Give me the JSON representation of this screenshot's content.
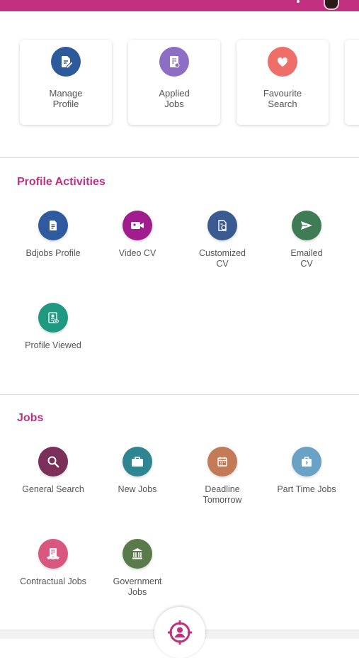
{
  "colors": {
    "brand": "#c0307f",
    "manage_profile": "#2d5a9a",
    "applied_jobs": "#8c6fc4",
    "favourite_search": "#ee6e6a",
    "bdjobs_profile": "#2f5aa0",
    "video_cv": "#a11c8c",
    "customized_cv": "#3a5a92",
    "emailed_cv": "#3f7b54",
    "profile_viewed": "#1f9a80",
    "general_search": "#7a3058",
    "new_jobs": "#2f8592",
    "deadline_tomorrow": "#c27a57",
    "part_time_jobs": "#6aa2c5",
    "contractual_jobs": "#d9567e",
    "government_jobs": "#5a7a4c"
  },
  "quick_cards": [
    {
      "label": "Manage\nProfile",
      "icon": "edit-document-icon"
    },
    {
      "label": "Applied\nJobs",
      "icon": "applied-document-icon"
    },
    {
      "label": "Favourite\nSearch",
      "icon": "heart-icon"
    }
  ],
  "profile_activities": {
    "title": "Profile Activities",
    "items": [
      {
        "label": "Bdjobs Profile",
        "icon": "document-icon"
      },
      {
        "label": "Video CV",
        "icon": "video-camera-icon"
      },
      {
        "label": "Customized\nCV",
        "icon": "custom-document-icon"
      },
      {
        "label": "Emailed\nCV",
        "icon": "send-icon"
      },
      {
        "label": "Profile Viewed",
        "icon": "profile-viewed-icon"
      }
    ]
  },
  "jobs": {
    "title": "Jobs",
    "items": [
      {
        "label": "General Search",
        "icon": "search-icon"
      },
      {
        "label": "New Jobs",
        "icon": "briefcase-icon"
      },
      {
        "label": "Deadline\nTomorrow",
        "icon": "calendar-icon"
      },
      {
        "label": "Part Time Jobs",
        "icon": "part-time-briefcase-icon"
      },
      {
        "label": "Contractual Jobs",
        "icon": "contract-icon"
      },
      {
        "label": "Government\nJobs",
        "icon": "government-building-icon"
      }
    ]
  },
  "fab": {
    "icon": "profile-target-icon"
  }
}
